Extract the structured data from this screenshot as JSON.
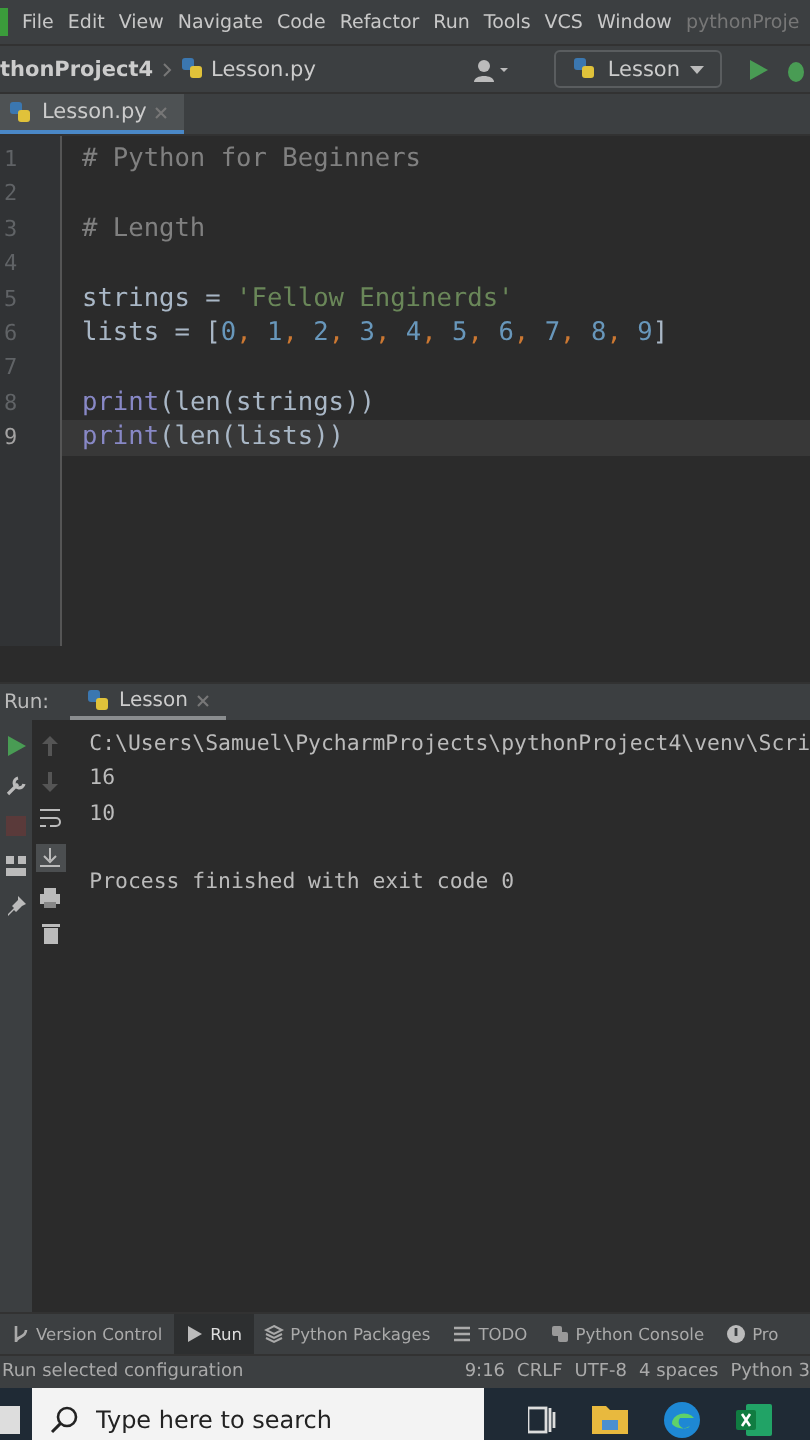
{
  "menu_bar": {
    "items": [
      "File",
      "Edit",
      "View",
      "Navigate",
      "Code",
      "Refactor",
      "Run",
      "Tools",
      "VCS",
      "Window"
    ],
    "project_title": "pythonProje"
  },
  "nav_bar": {
    "breadcrumbs": [
      "thonProject4",
      "Lesson.py"
    ],
    "run_config": "Lesson"
  },
  "editor_tabs": [
    {
      "label": "Lesson.py",
      "selected": true
    }
  ],
  "editor": {
    "lines": [
      {
        "number": "1",
        "current": false,
        "tokens": [
          {
            "text": "# Python for Beginners",
            "kind": "comment"
          }
        ]
      },
      {
        "number": "2",
        "current": false
      },
      {
        "number": "3",
        "current": false,
        "tokens": [
          {
            "text": "# Length",
            "kind": "comment"
          }
        ]
      },
      {
        "number": "4",
        "current": false
      },
      {
        "number": "5",
        "current": false,
        "tokens": [
          {
            "text": "strings = ",
            "kind": "plain"
          },
          {
            "text": "'Fellow Enginerds'",
            "kind": "string"
          }
        ]
      },
      {
        "number": "6",
        "current": false,
        "tokens": [
          {
            "text": "lists = [",
            "kind": "plain"
          },
          {
            "text": "0",
            "kind": "number"
          },
          {
            "text": ", ",
            "kind": "punct"
          },
          {
            "text": "1",
            "kind": "number"
          },
          {
            "text": ", ",
            "kind": "punct"
          },
          {
            "text": "2",
            "kind": "number"
          },
          {
            "text": ", ",
            "kind": "punct"
          },
          {
            "text": "3",
            "kind": "number"
          },
          {
            "text": ", ",
            "kind": "punct"
          },
          {
            "text": "4",
            "kind": "number"
          },
          {
            "text": ", ",
            "kind": "punct"
          },
          {
            "text": "5",
            "kind": "number"
          },
          {
            "text": ", ",
            "kind": "punct"
          },
          {
            "text": "6",
            "kind": "number"
          },
          {
            "text": ", ",
            "kind": "punct"
          },
          {
            "text": "7",
            "kind": "number"
          },
          {
            "text": ", ",
            "kind": "punct"
          },
          {
            "text": "8",
            "kind": "number"
          },
          {
            "text": ", ",
            "kind": "punct"
          },
          {
            "text": "9",
            "kind": "number"
          },
          {
            "text": "]",
            "kind": "plain"
          }
        ]
      },
      {
        "number": "7",
        "current": false
      },
      {
        "number": "8",
        "current": false,
        "tokens": [
          {
            "text": "print",
            "kind": "builtin"
          },
          {
            "text": "(len(strings))",
            "kind": "plain"
          }
        ]
      },
      {
        "number": "9",
        "current": true,
        "tokens": [
          {
            "text": "print",
            "kind": "builtin"
          },
          {
            "text": "(len(lists))",
            "kind": "plain"
          }
        ]
      }
    ]
  },
  "run_panel": {
    "label": "Run:",
    "tabs": [
      {
        "label": "Lesson",
        "selected": true
      }
    ],
    "output": [
      {
        "text": "C:\\Users\\Samuel\\PycharmProjects\\pythonProject4\\venv\\Scri",
        "kind": "command"
      },
      {
        "text": "16",
        "kind": "stdout"
      },
      {
        "text": "10",
        "kind": "stdout"
      },
      {
        "text": "Process finished with exit code 0",
        "kind": "exit"
      }
    ]
  },
  "tool_windows": [
    {
      "label": "Version Control",
      "selected": false
    },
    {
      "label": "Run",
      "selected": true
    },
    {
      "label": "Python Packages",
      "selected": false
    },
    {
      "label": "TODO",
      "selected": false
    },
    {
      "label": "Python Console",
      "selected": false
    },
    {
      "label": "Pro",
      "selected": false
    }
  ],
  "status_bar": {
    "message": "Run selected configuration",
    "items": [
      "9:16",
      "CRLF",
      "UTF-8",
      "4 spaces",
      "Python 3"
    ]
  },
  "taskbar": {
    "search": {
      "placeholder": "Type here to search"
    }
  }
}
